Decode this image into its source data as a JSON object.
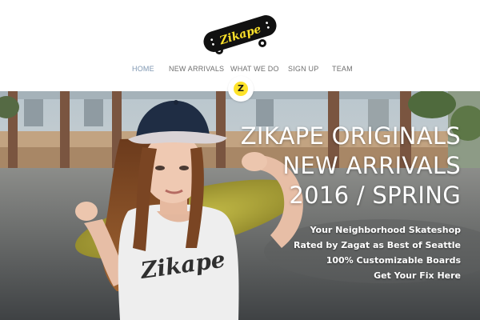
{
  "brand": {
    "logo_text": "Zikape",
    "logo_icon": "skateboard-logo",
    "badge_letter": "Z",
    "accent_color": "#ffe32a",
    "deck_color": "#111111"
  },
  "nav": {
    "items": [
      {
        "label": "HOME",
        "active": true
      },
      {
        "label": "NEW ARRIVALS",
        "active": false
      },
      {
        "label": "WHAT WE DO",
        "active": false
      },
      {
        "label": "SIGN UP",
        "active": false
      },
      {
        "label": "TEAM",
        "active": false
      }
    ]
  },
  "hero": {
    "headline": [
      "ZIKAPE ORIGINALS",
      "NEW ARRIVALS",
      "2016 / SPRING"
    ],
    "taglines": [
      "Your Neighborhood Skateshop",
      "Rated by Zagat as Best of Seattle",
      "100% Customizable Boards",
      "Get Your Fix Here"
    ],
    "shirt_print": "Zikape",
    "image": "model-with-skateboard-photo"
  }
}
